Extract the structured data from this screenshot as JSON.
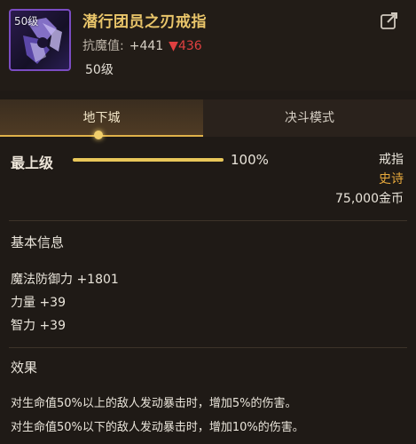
{
  "item": {
    "icon_level": "50级",
    "name": "潜行团员之刃戒指",
    "stat_label": "抗魔值:",
    "stat_gain": "+441",
    "stat_loss": "▼436",
    "level": "50级"
  },
  "tabs": {
    "dungeon": "地下城",
    "duel": "决斗模式"
  },
  "upgrade": {
    "label": "最上级",
    "percent_text": "100%",
    "progress": 1.0
  },
  "info": {
    "type": "戒指",
    "rarity": "史诗",
    "price": "75,000金币"
  },
  "basic": {
    "title": "基本信息",
    "attrs": [
      "魔法防御力 +1801",
      "力量 +39",
      "智力 +39"
    ]
  },
  "effects": {
    "title": "效果",
    "lines": [
      "对生命值50%以上的敌人发动暴击时，增加5%的伤害。",
      "对生命值50%以下的敌人发动暴击时，增加10%的伤害。"
    ]
  },
  "colors": {
    "name": "#e9c56a",
    "rarity": "#e6a83c",
    "loss": "#e04040",
    "accent": "#e8c75a"
  }
}
